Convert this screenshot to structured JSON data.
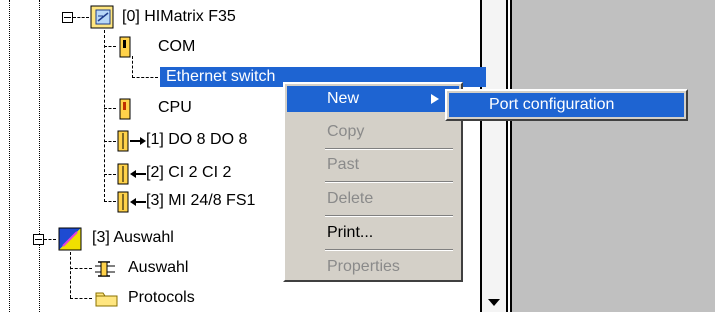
{
  "tree": {
    "root": {
      "label": "[0] HIMatrix F35"
    },
    "children": [
      {
        "label": "COM"
      },
      {
        "label": "Ethernet switch"
      },
      {
        "label": "CPU"
      },
      {
        "label": "[1] DO 8 DO 8"
      },
      {
        "label": "[2] CI 2 CI 2"
      },
      {
        "label": "[3] MI 24/8 FS1"
      }
    ],
    "auswahl": {
      "label": "[3] Auswahl"
    },
    "auswahl_children": [
      {
        "label": "Auswahl"
      },
      {
        "label": "Protocols"
      }
    ]
  },
  "context_menu": {
    "items": [
      {
        "label": "New",
        "enabled": true
      },
      {
        "label": "Copy",
        "enabled": false
      },
      {
        "label": "Past",
        "enabled": false
      },
      {
        "label": "Delete",
        "enabled": false
      },
      {
        "label": "Print...",
        "enabled": true
      },
      {
        "label": "Properties",
        "enabled": false
      }
    ],
    "submenu": {
      "label": "Port configuration"
    }
  },
  "colors": {
    "selection": "#1e64d2",
    "menu_bg": "#d4d0c8",
    "panel_bg": "#c0c0c0"
  }
}
